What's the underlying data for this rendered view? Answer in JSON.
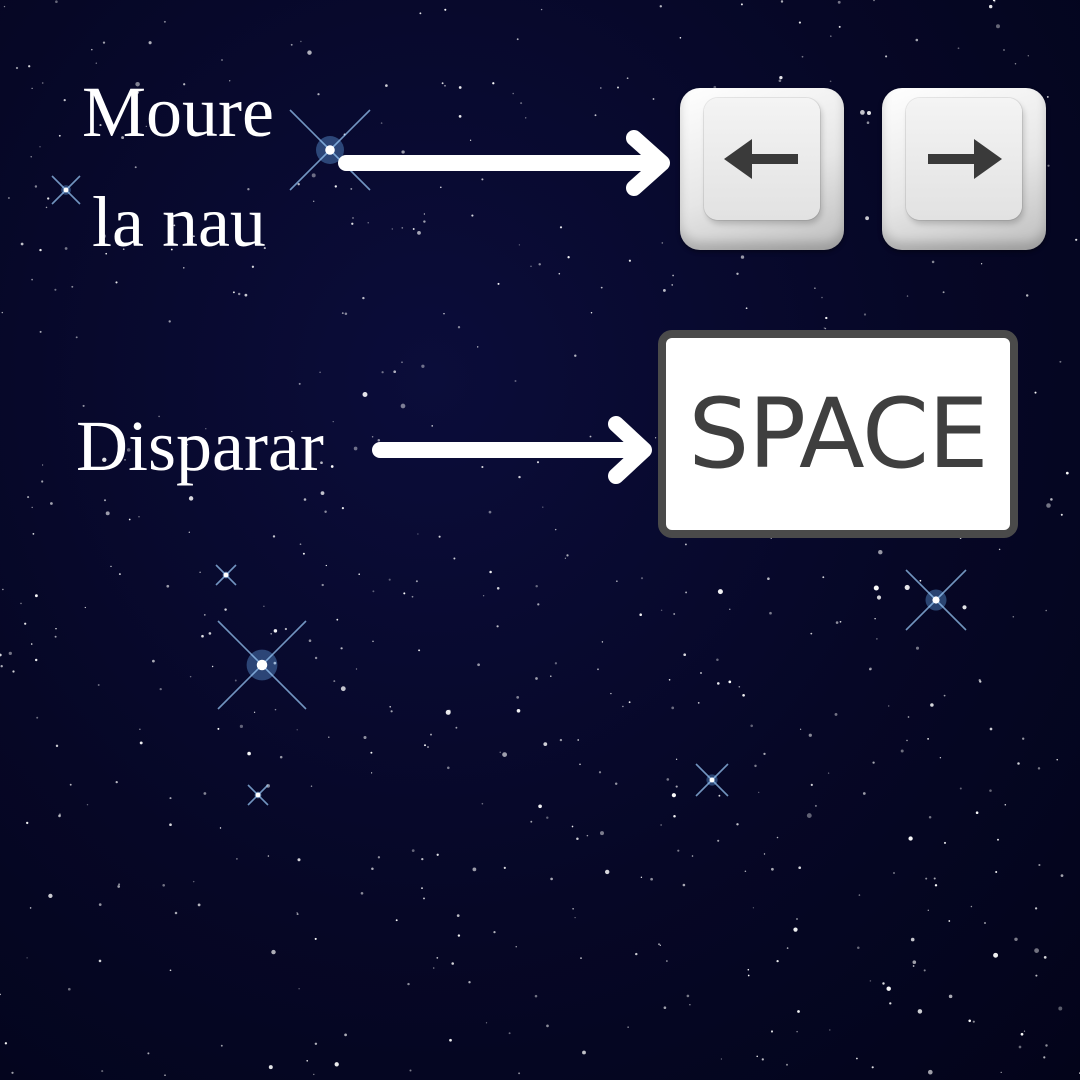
{
  "instructions": {
    "move_line1": "Moure",
    "move_line2": "la nau",
    "fire": "Disparar"
  },
  "keys": {
    "left_icon": "left-arrow-icon",
    "right_icon": "right-arrow-icon",
    "space_label": "SPACE"
  },
  "colors": {
    "background": "#060726",
    "text": "#ffffff",
    "arrow": "#ffffff",
    "key_glyph": "#3a3a3a",
    "space_border": "#4a4a4a"
  }
}
